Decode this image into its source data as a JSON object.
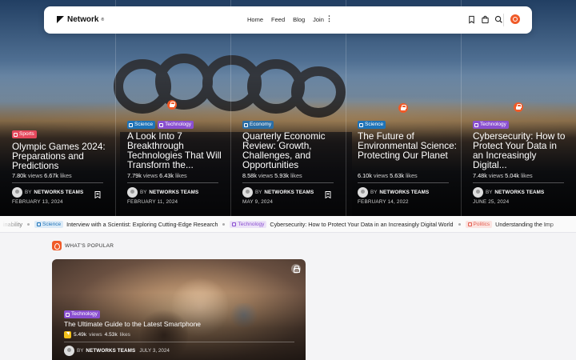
{
  "navbar": {
    "logo_text": "Network",
    "logo_sup": "®",
    "links": [
      "Home",
      "Feed",
      "Blog",
      "Join"
    ],
    "more_icon": "more-vertical-icon",
    "icons": [
      "bookmark-icon",
      "shopping-bag-icon",
      "search-icon"
    ],
    "user_icon": "user-avatar-icon"
  },
  "colors": {
    "accent": "#f05a28",
    "sports": "#e5485c",
    "science": "#1e73b8",
    "technology": "#8a4fd0",
    "economy": "#2c6ea5",
    "politics": "#e35d4f"
  },
  "hero_cards": [
    {
      "tags": [
        {
          "label": "Sports",
          "color": "#e5485c"
        }
      ],
      "title": "Olympic Games 2024: Preparations and Predictions",
      "views": "7.80k",
      "likes": "6.67k",
      "views_label": "views",
      "likes_label": "likes",
      "author_prefix": "BY",
      "author": "NETWORKS TEAMS",
      "date": "FEBRUARY 13, 2024",
      "locked": false
    },
    {
      "tags": [
        {
          "label": "Science",
          "color": "#1e73b8"
        },
        {
          "label": "Technology",
          "color": "#8a4fd0"
        }
      ],
      "title": "A Look Into 7 Breakthrough Technologies That Will Transform the...",
      "views": "7.79k",
      "likes": "6.43k",
      "views_label": "views",
      "likes_label": "likes",
      "author_prefix": "BY",
      "author": "NETWORKS TEAMS",
      "date": "FEBRUARY 11, 2024",
      "locked": true
    },
    {
      "tags": [
        {
          "label": "Economy",
          "color": "#2c6ea5"
        }
      ],
      "title": "Quarterly Economic Review: Growth, Challenges, and Opportunities",
      "views": "8.58k",
      "likes": "5.93k",
      "views_label": "views",
      "likes_label": "likes",
      "author_prefix": "BY",
      "author": "NETWORKS TEAMS",
      "date": "MAY 9, 2024",
      "locked": false
    },
    {
      "tags": [
        {
          "label": "Science",
          "color": "#1e73b8"
        }
      ],
      "title": "The Future of Environmental Science: Protecting Our Planet",
      "views": "6.10k",
      "likes": "5.63k",
      "views_label": "views",
      "likes_label": "likes",
      "author_prefix": "BY",
      "author": "NETWORKS TEAMS",
      "date": "FEBRUARY 14, 2022",
      "locked": true
    },
    {
      "tags": [
        {
          "label": "Technology",
          "color": "#8a4fd0"
        }
      ],
      "title": "Cybersecurity: How to Protect Your Data in an Increasingly Digital...",
      "views": "7.48k",
      "likes": "5.04k",
      "views_label": "views",
      "likes_label": "likes",
      "author_prefix": "BY",
      "author": "NETWORKS TEAMS",
      "date": "JUNE 25, 2024",
      "locked": true
    }
  ],
  "ticker": {
    "lead_text": "inability",
    "items": [
      {
        "tag": "Science",
        "tag_color": "#1e73b8",
        "tag_bg": "#dcebf7",
        "text": "Interview with a Scientist: Exploring Cutting-Edge Research"
      },
      {
        "tag": "Technology",
        "tag_color": "#8a4fd0",
        "tag_bg": "#ece2f8",
        "text": "Cybersecurity: How to Protect Your Data in an Increasingly Digital World"
      },
      {
        "tag": "Politics",
        "tag_color": "#e35d4f",
        "tag_bg": "#fbe3e0",
        "text": "Understanding the Imp"
      }
    ]
  },
  "popular": {
    "heading": "WHAT'S POPULAR",
    "heading_icon": "fire-icon",
    "feature": {
      "tag": "Technology",
      "tag_color": "#8a4fd0",
      "title": "The Ultimate Guide to the Latest Smartphone",
      "views": "5.49k",
      "views_label": "views",
      "likes": "4.53k",
      "likes_label": "likes",
      "author_prefix": "BY",
      "author": "NETWORKS TEAMS",
      "date": "JULY 3, 2024",
      "trending_icon": "bolt-icon",
      "lock_icon": "lock-icon"
    }
  }
}
